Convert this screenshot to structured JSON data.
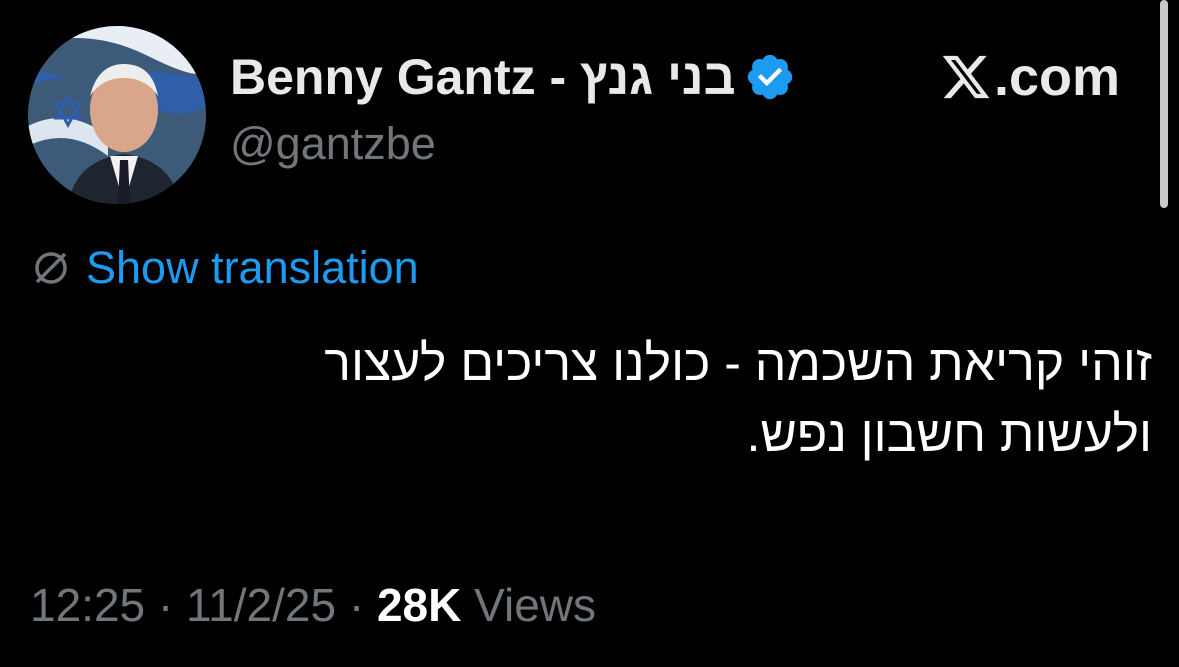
{
  "tweet": {
    "display_name": "Benny Gantz - בני גנץ",
    "handle": "@gantzbe",
    "verified": true,
    "source": ".com",
    "translate_label": "Show translation",
    "text_lines": [
      "זוהי קריאת השכמה - כולנו צריכים לעצור",
      "ולעשות חשבון נפש."
    ],
    "time": "12:25",
    "date": "11/2/25",
    "separator": "·",
    "views_count": "28K",
    "views_label": "Views"
  },
  "icons": {
    "verified": "verified-badge-icon",
    "brand": "x-logo-icon",
    "translate": "globe-icon"
  },
  "colors": {
    "background": "#000000",
    "accent": "#1d9bf0",
    "muted": "#71767b",
    "text": "#e7e9ea"
  }
}
